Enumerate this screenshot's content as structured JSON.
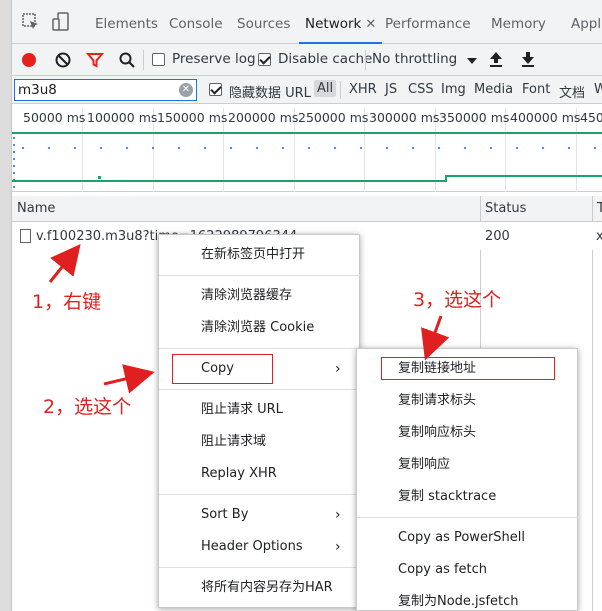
{
  "devtools": {
    "tabs": [
      "Elements",
      "Console",
      "Sources",
      "Network",
      "Performance",
      "Memory",
      "Appli"
    ],
    "active_tab": "Network"
  },
  "toolbar": {
    "preserve_log": "Preserve log",
    "disable_cache": "Disable cache",
    "throttling": "No throttling"
  },
  "filter": {
    "value": "m3u8",
    "hide_data_urls": "隐藏数据 URL",
    "types": [
      "All",
      "XHR",
      "JS",
      "CSS",
      "Img",
      "Media",
      "Font",
      "文档",
      "W"
    ]
  },
  "timeline": {
    "ticks": [
      "50000 ms",
      "100000 ms",
      "150000 ms",
      "200000 ms",
      "250000 ms",
      "300000 ms",
      "350000 ms",
      "400000 ms",
      "450"
    ]
  },
  "table": {
    "columns": [
      "Name",
      "Status",
      "T"
    ],
    "row": {
      "name": "v.f100230.m3u8?time=1622989796344",
      "status": "200",
      "type": "x"
    }
  },
  "context_menu": {
    "items": [
      "在新标签页中打开",
      "清除浏览器缓存",
      "清除浏览器 Cookie",
      "Copy",
      "阻止请求 URL",
      "阻止请求域",
      "Replay XHR",
      "Sort By",
      "Header Options",
      "将所有内容另存为HAR"
    ]
  },
  "copy_submenu": {
    "items": [
      "复制链接地址",
      "复制请求标头",
      "复制响应标头",
      "复制响应",
      "复制 stacktrace",
      "Copy as PowerShell",
      "Copy as fetch",
      "复制为Node.jsfetch"
    ]
  },
  "annotations": {
    "step1": "1，右键",
    "step2": "2，选这个",
    "step3": "3，选这个"
  },
  "colors": {
    "annotation_red": "#e02020",
    "accent_blue": "#1a73e8",
    "timeline_green": "#1aa36a"
  }
}
